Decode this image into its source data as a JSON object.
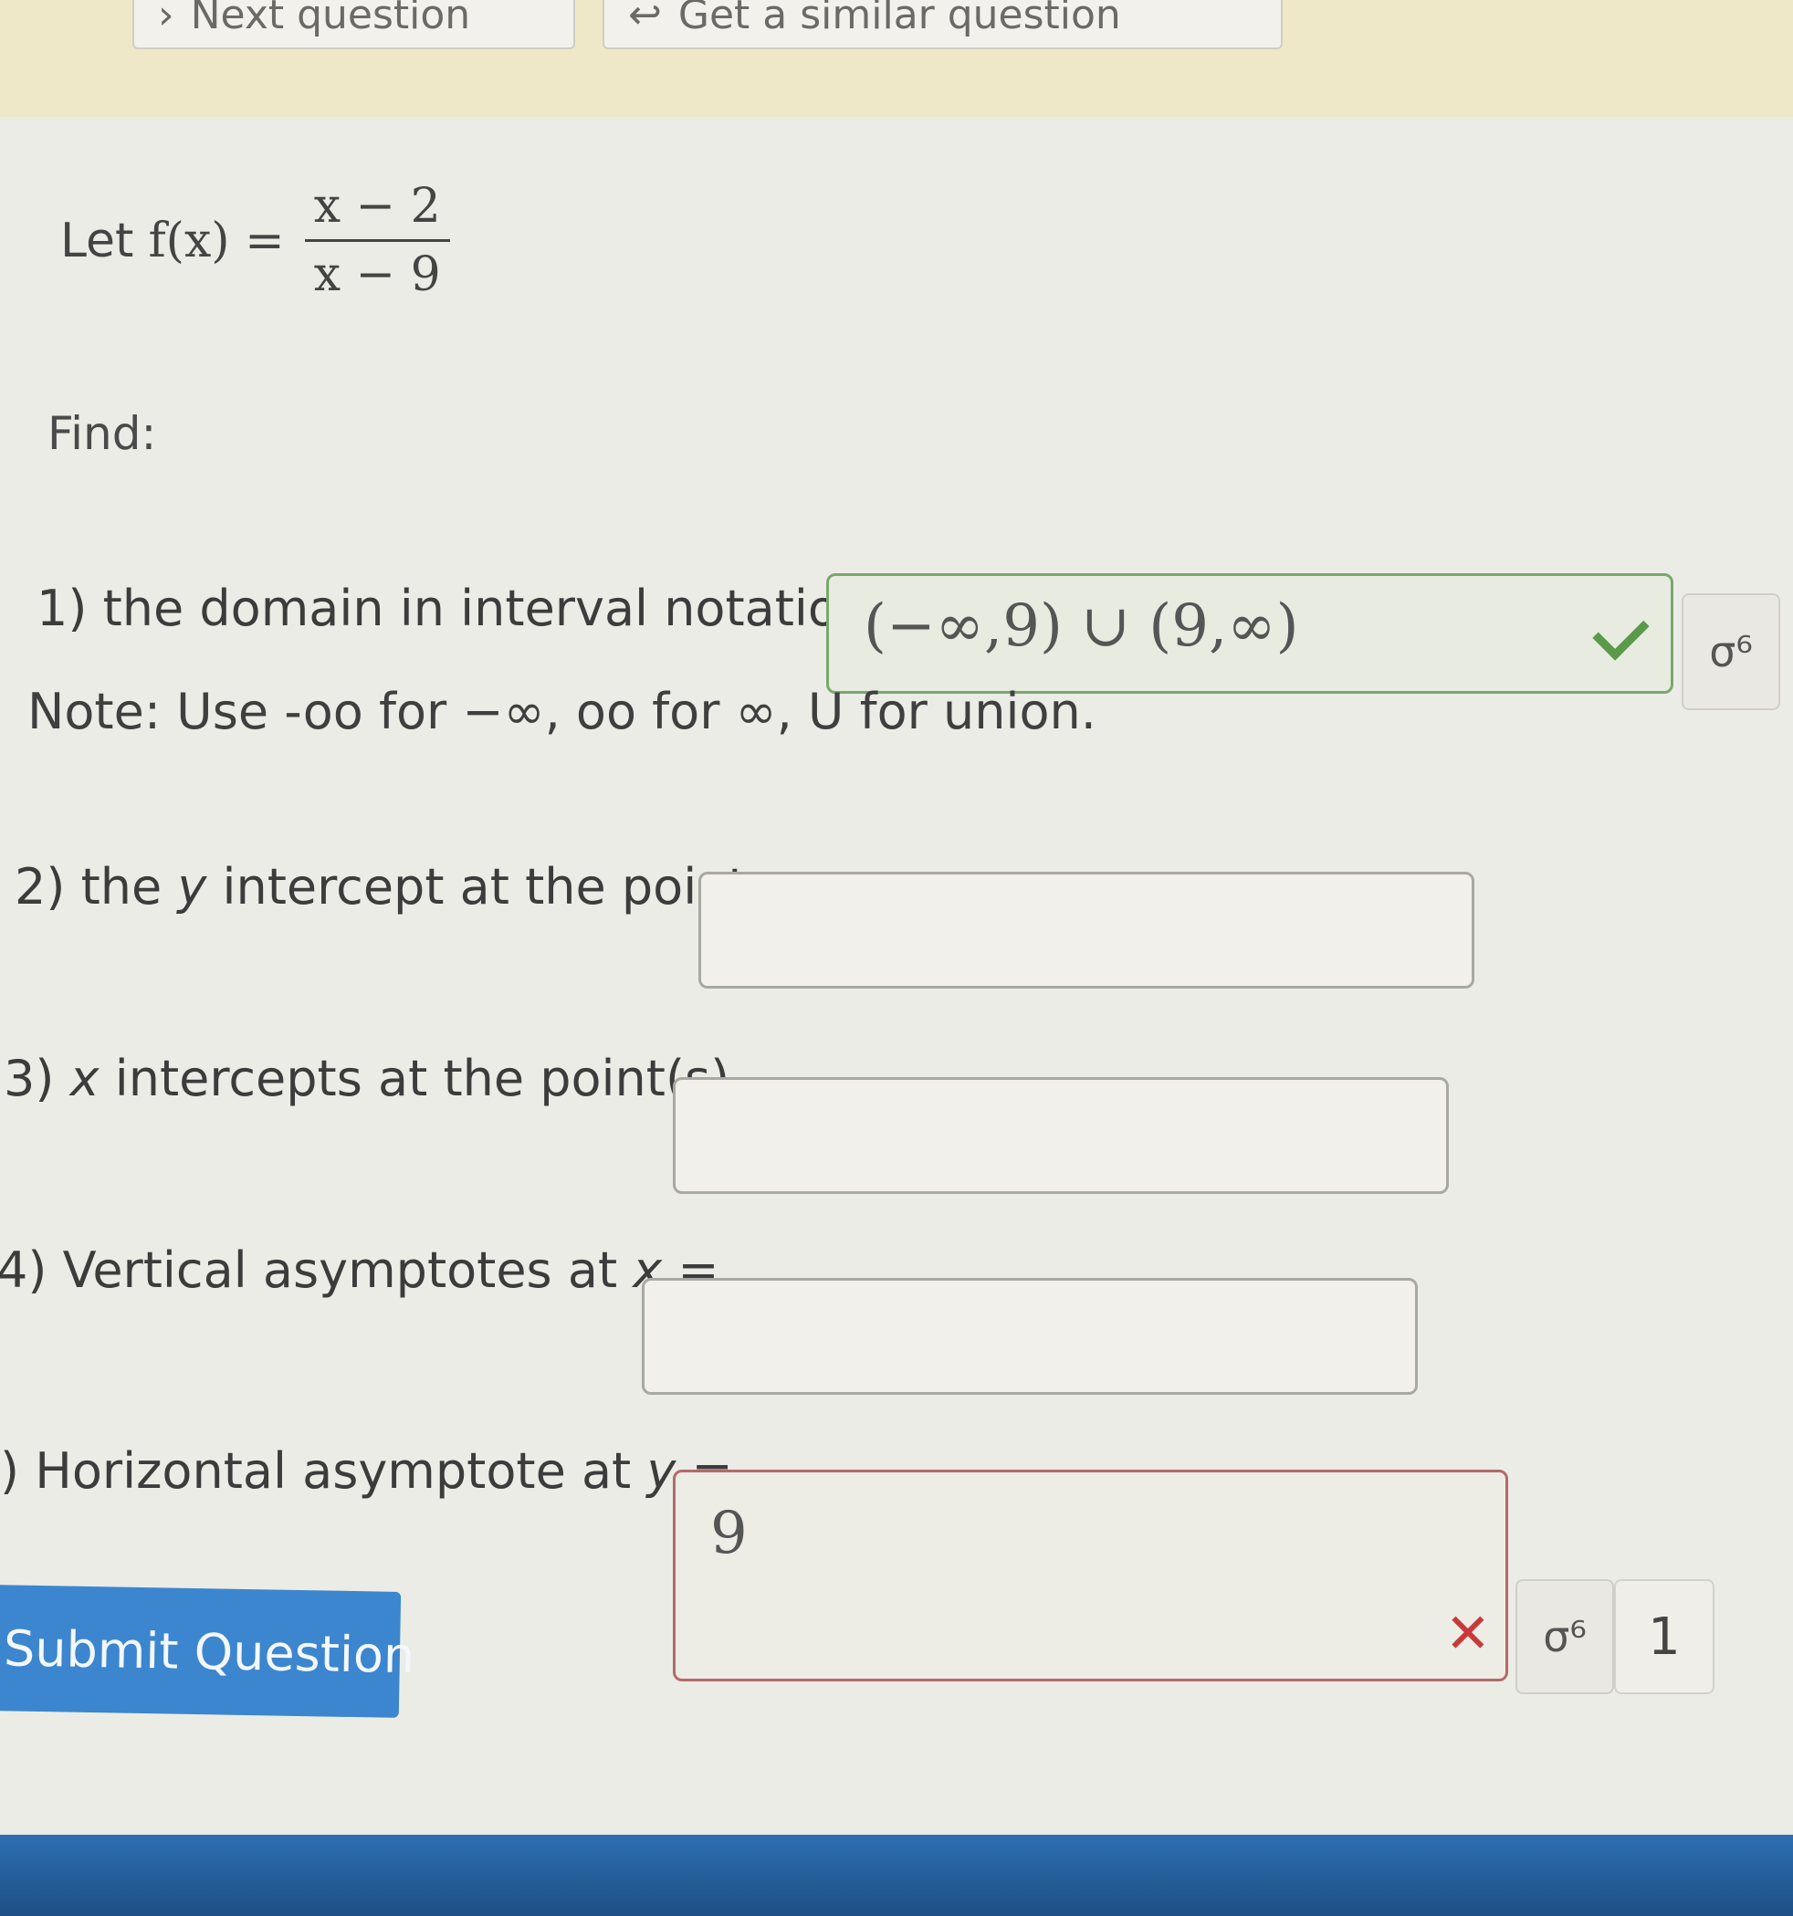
{
  "toolbar": {
    "next_question_label": "Next question",
    "next_question_glyph": "›",
    "similar_question_label": "Get a similar question",
    "similar_question_glyph": "↩"
  },
  "problem": {
    "let_word": "Let",
    "function_lhs": "f(x) =",
    "numerator": "x − 2",
    "denominator": "x − 9",
    "find_label": "Find:"
  },
  "questions": [
    {
      "label": "1) the domain in interval notation",
      "answer": "(−∞,9) ∪ (9,∞)",
      "status": "correct"
    },
    {
      "label_prefix": "2) the ",
      "label_var": "y",
      "label_suffix": " intercept at the point",
      "answer": ""
    },
    {
      "label_prefix": "3) ",
      "label_var": "x",
      "label_suffix": " intercepts at the point(s)",
      "answer": ""
    },
    {
      "label_prefix": "4) Vertical asymptotes at ",
      "label_var": "x",
      "label_suffix": " =",
      "answer": ""
    },
    {
      "label_prefix": ") Horizontal asymptote at ",
      "label_var": "y",
      "label_suffix": " =",
      "answer": "9",
      "status": "wrong",
      "attempts": "1"
    }
  ],
  "note": "Note: Use -oo for −∞, oo for ∞, U for union.",
  "submit_label": "Submit Question",
  "preview_glyph": "σ⁶",
  "colors": {
    "correct_border": "#7aa86c",
    "wrong_border": "#b46a6a",
    "check": "#5a9a4a",
    "cross": "#c83a3a",
    "submit_bg": "#3b86cf"
  },
  "icons": {
    "check": "check-icon",
    "cross": "x-icon",
    "preview": "preview-icon"
  }
}
